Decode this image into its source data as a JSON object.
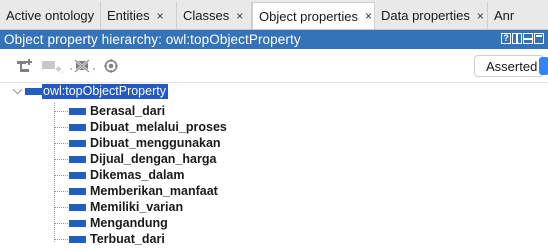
{
  "tabs": [
    {
      "label": "Active ontology",
      "close": "×"
    },
    {
      "label": "Entities",
      "close": "×"
    },
    {
      "label": "Classes",
      "close": "×"
    },
    {
      "label": "Object properties",
      "close": "×",
      "active": true
    },
    {
      "label": "Data properties",
      "close": "×"
    },
    {
      "label": "Anr",
      "close": ""
    }
  ],
  "panel": {
    "title": "Object property hierarchy: owl:topObjectProperty",
    "help_glyph": "?"
  },
  "toolbar": {
    "icons": [
      "add-subproperty-icon",
      "add-sibling-icon",
      "delete-property-icon",
      "find-usage-icon"
    ],
    "mode_label": "Asserted"
  },
  "tree": {
    "root": "owl:topObjectProperty",
    "children": [
      "Berasal_dari",
      "Dibuat_melalui_proses",
      "Dibuat_menggunakan",
      "Dijual_dengan_harga",
      "Dikemas_dalam",
      "Memberikan_manfaat",
      "Memiliki_varian",
      "Mengandung",
      "Terbuat_dari"
    ]
  },
  "colors": {
    "title_bar": "#3573b9",
    "property_bar": "#1f5fc0",
    "selection": "#2458c4"
  }
}
